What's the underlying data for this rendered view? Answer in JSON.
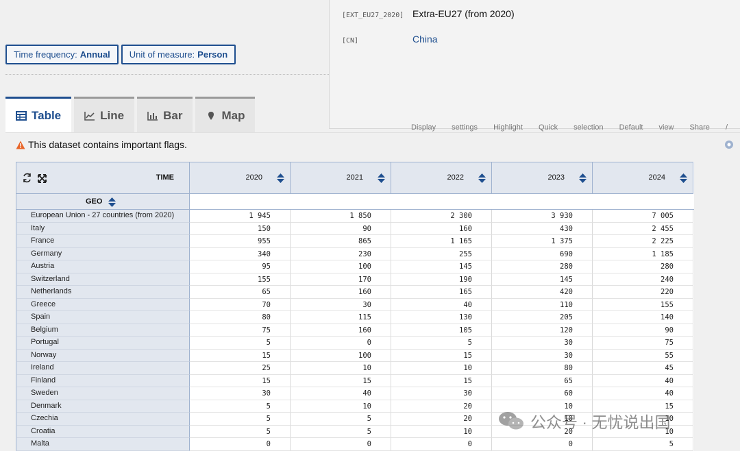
{
  "filters": [
    {
      "prefix": "Time frequency: ",
      "value": "Annual"
    },
    {
      "prefix": "Unit of measure: ",
      "value": "Person"
    }
  ],
  "popup": {
    "rows": [
      {
        "code": "[EXT_EU27_2020]",
        "label": "Extra-EU27 (from 2020)"
      },
      {
        "code": "[CN]",
        "label": "China"
      }
    ],
    "peek_text": "Display settings   Highlight   Quick selection   Default view   Share / bookmark   Download"
  },
  "tabs": [
    {
      "label": "Table",
      "icon": "table-icon",
      "active": true
    },
    {
      "label": "Line",
      "icon": "line-chart-icon",
      "active": false
    },
    {
      "label": "Bar",
      "icon": "bar-chart-icon",
      "active": false
    },
    {
      "label": "Map",
      "icon": "map-pin-icon",
      "active": false
    }
  ],
  "flags_notice": "This dataset contains important flags.",
  "table": {
    "time_label": "TIME",
    "geo_label": "GEO",
    "years": [
      "2020",
      "2021",
      "2022",
      "2023",
      "2024"
    ],
    "rows": [
      {
        "geo": "European Union - 27 countries (from 2020)",
        "values": [
          "1 945",
          "1 850",
          "2 300",
          "3 930",
          "7 005"
        ]
      },
      {
        "geo": "Italy",
        "values": [
          "150",
          "90",
          "160",
          "430",
          "2 455"
        ]
      },
      {
        "geo": "France",
        "values": [
          "955",
          "865",
          "1 165",
          "1 375",
          "2 225"
        ]
      },
      {
        "geo": "Germany",
        "values": [
          "340",
          "230",
          "255",
          "690",
          "1 185"
        ]
      },
      {
        "geo": "Austria",
        "values": [
          "95",
          "100",
          "145",
          "280",
          "280"
        ]
      },
      {
        "geo": "Switzerland",
        "values": [
          "155",
          "170",
          "190",
          "145",
          "240"
        ]
      },
      {
        "geo": "Netherlands",
        "values": [
          "65",
          "160",
          "165",
          "420",
          "220"
        ]
      },
      {
        "geo": "Greece",
        "values": [
          "70",
          "30",
          "40",
          "110",
          "155"
        ]
      },
      {
        "geo": "Spain",
        "values": [
          "80",
          "115",
          "130",
          "205",
          "140"
        ]
      },
      {
        "geo": "Belgium",
        "values": [
          "75",
          "160",
          "105",
          "120",
          "90"
        ]
      },
      {
        "geo": "Portugal",
        "values": [
          "5",
          "0",
          "5",
          "30",
          "75"
        ]
      },
      {
        "geo": "Norway",
        "values": [
          "15",
          "100",
          "15",
          "30",
          "55"
        ]
      },
      {
        "geo": "Ireland",
        "values": [
          "25",
          "10",
          "10",
          "80",
          "45"
        ]
      },
      {
        "geo": "Finland",
        "values": [
          "15",
          "15",
          "15",
          "65",
          "40"
        ]
      },
      {
        "geo": "Sweden",
        "values": [
          "30",
          "40",
          "30",
          "60",
          "40"
        ]
      },
      {
        "geo": "Denmark",
        "values": [
          "5",
          "10",
          "20",
          "10",
          "15"
        ]
      },
      {
        "geo": "Czechia",
        "values": [
          "5",
          "5",
          "20",
          "10",
          "10"
        ]
      },
      {
        "geo": "Croatia",
        "values": [
          "5",
          "5",
          "10",
          "20",
          "10"
        ]
      },
      {
        "geo": "Malta",
        "values": [
          "0",
          "0",
          "0",
          "0",
          "5"
        ]
      }
    ]
  },
  "watermark": "公众号 · 无忧说出国",
  "colors": {
    "accent": "#1f4f8f",
    "header_bg": "#e2e7ef",
    "warning": "#e8662a"
  }
}
